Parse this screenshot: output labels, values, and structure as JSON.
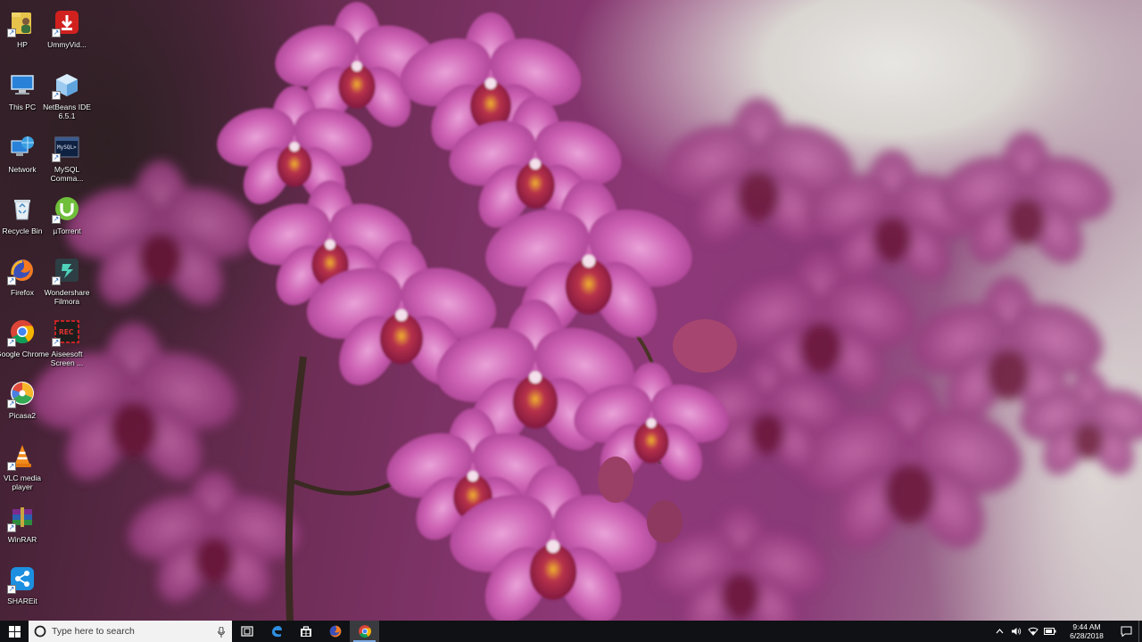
{
  "desktop": {
    "icons": [
      {
        "label": "HP",
        "icon": "user-folder-icon"
      },
      {
        "label": "UmmyVid...",
        "icon": "ummy-download-icon"
      },
      {
        "label": "This PC",
        "icon": "computer-icon"
      },
      {
        "label": "NetBeans IDE 6.5.1",
        "icon": "netbeans-cube-icon"
      },
      {
        "label": "Network",
        "icon": "network-globe-icon"
      },
      {
        "label": "MySQL Comma...",
        "icon": "mysql-console-icon"
      },
      {
        "label": "Recycle Bin",
        "icon": "recycle-bin-icon"
      },
      {
        "label": "µTorrent",
        "icon": "utorrent-icon"
      },
      {
        "label": "Firefox",
        "icon": "firefox-icon"
      },
      {
        "label": "Wondershare Filmora",
        "icon": "filmora-icon"
      },
      {
        "label": "Google Chrome",
        "icon": "chrome-icon"
      },
      {
        "label": "Aiseesoft Screen ...",
        "icon": "aiseesoft-rec-icon"
      },
      {
        "label": "Picasa2",
        "icon": "picasa-icon"
      },
      {
        "label": "VLC media player",
        "icon": "vlc-cone-icon"
      },
      {
        "label": "WinRAR",
        "icon": "winrar-books-icon"
      },
      {
        "label": "SHAREit",
        "icon": "shareit-icon"
      }
    ]
  },
  "taskbar": {
    "search_placeholder": "Type here to search",
    "pinned": [
      "task-view-icon",
      "edge-icon",
      "store-icon",
      "firefox-icon",
      "chrome-icon"
    ],
    "active_app": "chrome-icon",
    "clock_time": "9:44 AM",
    "clock_date": "6/28/2018"
  },
  "colors": {
    "taskbar": "#101114",
    "search_box": "#f2f2f2",
    "orchid": "#c54fa6",
    "active_indicator": "#7aa7e0"
  }
}
